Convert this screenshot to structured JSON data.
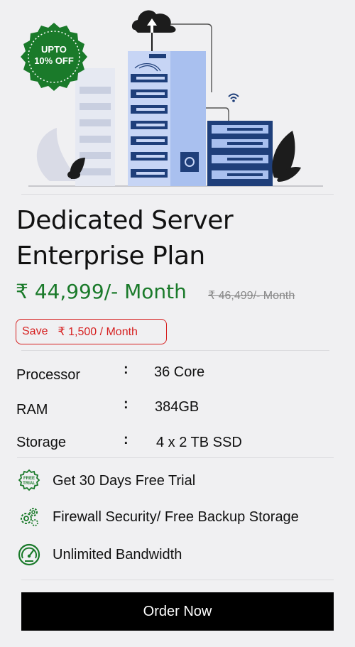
{
  "badge": {
    "line1": "UPTO",
    "line2": "10% OFF"
  },
  "plan": {
    "title_line1": "Dedicated Server",
    "title_line2": "Enterprise Plan",
    "price": "₹ 44,999/- Month",
    "old_price": "₹ 46,499/- Month",
    "save_label": "Save",
    "save_amount": "₹ 1,500 / Month"
  },
  "specs": [
    {
      "key": "Processor",
      "value": "36 Core"
    },
    {
      "key": "RAM",
      "value": "384GB"
    },
    {
      "key": "Storage",
      "value": "4 x 2 TB SSD"
    }
  ],
  "separator": ":",
  "features": [
    {
      "label": "Get 30 Days Free Trial",
      "icon": "free-trial-icon"
    },
    {
      "label": "Firewall Security/ Free Backup Storage",
      "icon": "gears-icon"
    },
    {
      "label": "Unlimited Bandwidth",
      "icon": "speedometer-icon"
    }
  ],
  "order_button": "Order Now",
  "colors": {
    "accent_green": "#1a7a2a",
    "save_red": "#d61f1f",
    "button_black": "#000000",
    "server_blue": "#1f3f7a"
  }
}
